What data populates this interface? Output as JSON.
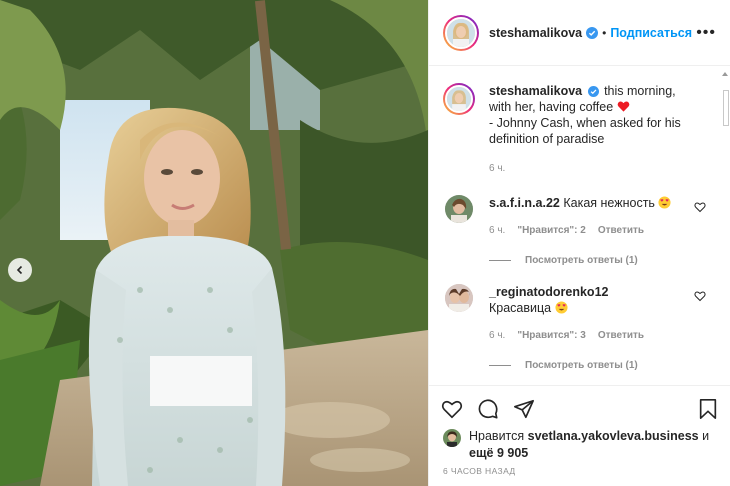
{
  "header": {
    "username": "steshamalikova",
    "follow_label": "Подписаться",
    "separator": "•",
    "more_label": "•••"
  },
  "caption": {
    "username": "steshamalikova",
    "text_line1": "this morning, with her, having coffee",
    "text_line2": "- Johnny Cash, when asked for his definition of paradise",
    "time": "6 ч."
  },
  "comments": [
    {
      "username": "s.a.f.i.n.a.22",
      "text": "Какая нежность",
      "time": "6 ч.",
      "likes": "\"Нравится\": 2",
      "reply_label": "Ответить",
      "view_replies": "Посмотреть ответы (1)"
    },
    {
      "username": "_reginatodorenko12",
      "text": "Красавица",
      "time": "6 ч.",
      "likes": "\"Нравится\": 3",
      "reply_label": "Ответить",
      "view_replies": "Посмотреть ответы (1)"
    }
  ],
  "likes": {
    "prefix": "Нравится",
    "user": "svetlana.yakovleva.business",
    "suffix_and": "и",
    "others_prefix": "ещё",
    "others_count": "9 905"
  },
  "timestamp": "6 ЧАСОВ НАЗАД",
  "colors": {
    "accent": "#0095f6",
    "heart_red": "#ed4956",
    "text": "#262626",
    "muted": "#8e8e8e"
  },
  "icons": {
    "verified": "verified-badge-icon",
    "heart": "heart-icon",
    "comment": "comment-icon",
    "share": "share-icon",
    "bookmark": "bookmark-icon",
    "prev": "chevron-left-icon"
  }
}
